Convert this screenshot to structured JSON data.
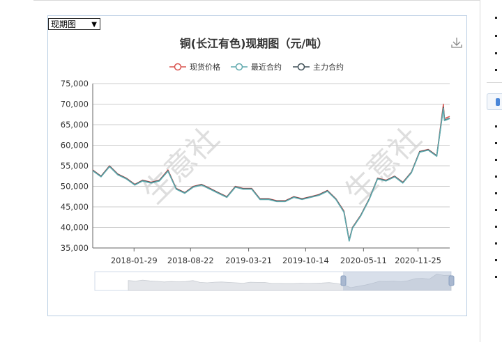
{
  "page": {
    "select_label": "现期图",
    "sidebar_bullet_count_top": 4,
    "sidebar_bullet_count_bottom": 10
  },
  "colors": {
    "spot": "#d9534f",
    "recent": "#5fa9ad",
    "main": "#3f4f57",
    "grid": "#cccccc",
    "axis_text": "#333333",
    "watermark": "#d0d0d0"
  },
  "watermark_text": "生意社",
  "chart_data": {
    "type": "line",
    "title": "铜(长江有色)现期图（元/吨）",
    "legend_position": "top-center",
    "grid": true,
    "xlabel": "",
    "ylabel": "",
    "ylim": [
      35000,
      75000
    ],
    "yticks": [
      "75,000",
      "70,000",
      "65,000",
      "60,000",
      "55,000",
      "50,000",
      "45,000",
      "40,000",
      "35,000"
    ],
    "xticks": [
      "2018-01-29",
      "2018-08-22",
      "2019-03-21",
      "2019-10-14",
      "2020-05-11",
      "2020-11-25"
    ],
    "x": [
      "2017-09-01",
      "2017-10-01",
      "2017-11-01",
      "2017-12-01",
      "2018-01-01",
      "2018-02-01",
      "2018-03-01",
      "2018-04-01",
      "2018-05-01",
      "2018-06-01",
      "2018-07-01",
      "2018-08-01",
      "2018-09-01",
      "2018-10-01",
      "2018-11-01",
      "2018-12-01",
      "2019-01-01",
      "2019-02-01",
      "2019-03-01",
      "2019-04-01",
      "2019-05-01",
      "2019-06-01",
      "2019-07-01",
      "2019-08-01",
      "2019-09-01",
      "2019-10-01",
      "2019-11-01",
      "2019-12-01",
      "2020-01-01",
      "2020-02-01",
      "2020-03-01",
      "2020-03-20",
      "2020-04-01",
      "2020-05-01",
      "2020-06-01",
      "2020-07-01",
      "2020-08-01",
      "2020-09-01",
      "2020-10-01",
      "2020-11-01",
      "2020-12-01",
      "2021-01-01",
      "2021-02-01",
      "2021-02-25",
      "2021-03-01",
      "2021-03-20"
    ],
    "series": [
      {
        "name": "现货价格",
        "values": [
          54000,
          52500,
          55000,
          53000,
          52000,
          50500,
          51500,
          51000,
          51500,
          54000,
          49500,
          48500,
          50000,
          50500,
          49500,
          48500,
          47500,
          50000,
          49500,
          49500,
          47000,
          47000,
          46500,
          46500,
          47500,
          47000,
          47500,
          48000,
          49000,
          47000,
          44000,
          37000,
          40000,
          43000,
          47000,
          52000,
          51500,
          52500,
          51000,
          53500,
          58500,
          59000,
          57500,
          70000,
          66500,
          67000
        ]
      },
      {
        "name": "最近合约",
        "values": [
          53800,
          52300,
          54800,
          52800,
          51800,
          50300,
          51300,
          50800,
          51300,
          53700,
          49300,
          48300,
          49800,
          50300,
          49300,
          48300,
          47300,
          49800,
          49300,
          49300,
          46800,
          46800,
          46300,
          46300,
          47300,
          46800,
          47300,
          47800,
          48800,
          46800,
          43700,
          36700,
          39800,
          42800,
          46800,
          51800,
          51300,
          52300,
          50800,
          53300,
          58300,
          58800,
          57300,
          69000,
          66000,
          66500
        ]
      },
      {
        "name": "主力合约",
        "values": [
          53900,
          52400,
          54900,
          52900,
          51900,
          50400,
          51400,
          50900,
          51400,
          53800,
          49400,
          48400,
          49900,
          50400,
          49400,
          48400,
          47400,
          49900,
          49400,
          49400,
          46900,
          46900,
          46400,
          46400,
          47400,
          46900,
          47400,
          47900,
          48900,
          46900,
          43800,
          36800,
          39900,
          42900,
          46900,
          51900,
          51400,
          52400,
          50900,
          53400,
          58400,
          58900,
          57400,
          69200,
          66100,
          66600
        ]
      }
    ]
  }
}
